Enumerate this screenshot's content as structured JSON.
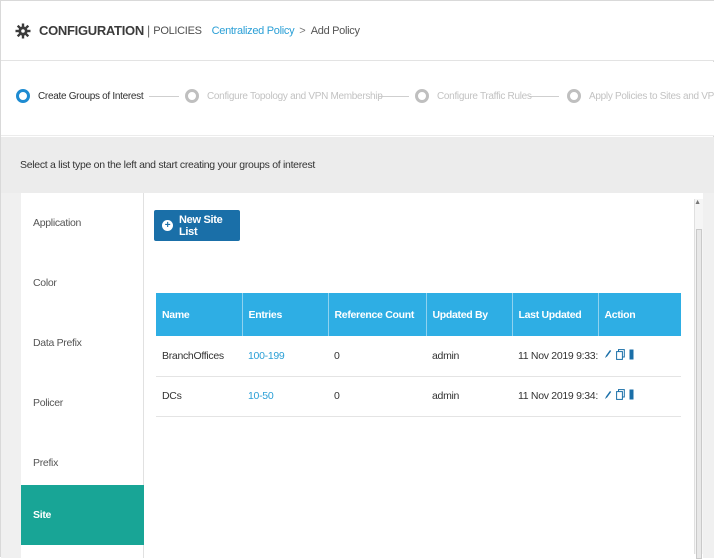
{
  "header": {
    "title": "CONFIGURATION",
    "separator": "|",
    "subtitle": "POLICIES",
    "breadcrumb_link": "Centralized Policy",
    "breadcrumb_arrow": ">",
    "breadcrumb_current": "Add Policy",
    "icon": "gear-icon"
  },
  "steps": [
    {
      "label": "Create Groups of Interest",
      "state": "active"
    },
    {
      "label": "Configure Topology and VPN Membership",
      "state": "inactive"
    },
    {
      "label": "Configure Traffic Rules",
      "state": "inactive"
    },
    {
      "label": "Apply Policies to Sites and VPNs",
      "state": "inactive"
    }
  ],
  "instruction": "Select a list type on the left and start creating your groups of interest",
  "sidebar": {
    "items": [
      {
        "label": "Application"
      },
      {
        "label": "Color"
      },
      {
        "label": "Data Prefix"
      },
      {
        "label": "Policer"
      },
      {
        "label": "Prefix"
      },
      {
        "label": "Site",
        "active": true
      }
    ]
  },
  "toolbar": {
    "new_label": "New Site List"
  },
  "table": {
    "columns": [
      "Name",
      "Entries",
      "Reference Count",
      "Updated By",
      "Last Updated",
      "Action"
    ],
    "rows": [
      {
        "name": "BranchOffices",
        "entries": "100-199",
        "reference_count": "0",
        "updated_by": "admin",
        "last_updated": "11 Nov 2019 9:33:..."
      },
      {
        "name": "DCs",
        "entries": "10-50",
        "reference_count": "0",
        "updated_by": "admin",
        "last_updated": "11 Nov 2019 9:34:..."
      }
    ]
  },
  "colors": {
    "accent_blue": "#1a6fa8",
    "table_header": "#2eaee4",
    "active_sidebar": "#18a596",
    "link": "#2a9fd6"
  }
}
